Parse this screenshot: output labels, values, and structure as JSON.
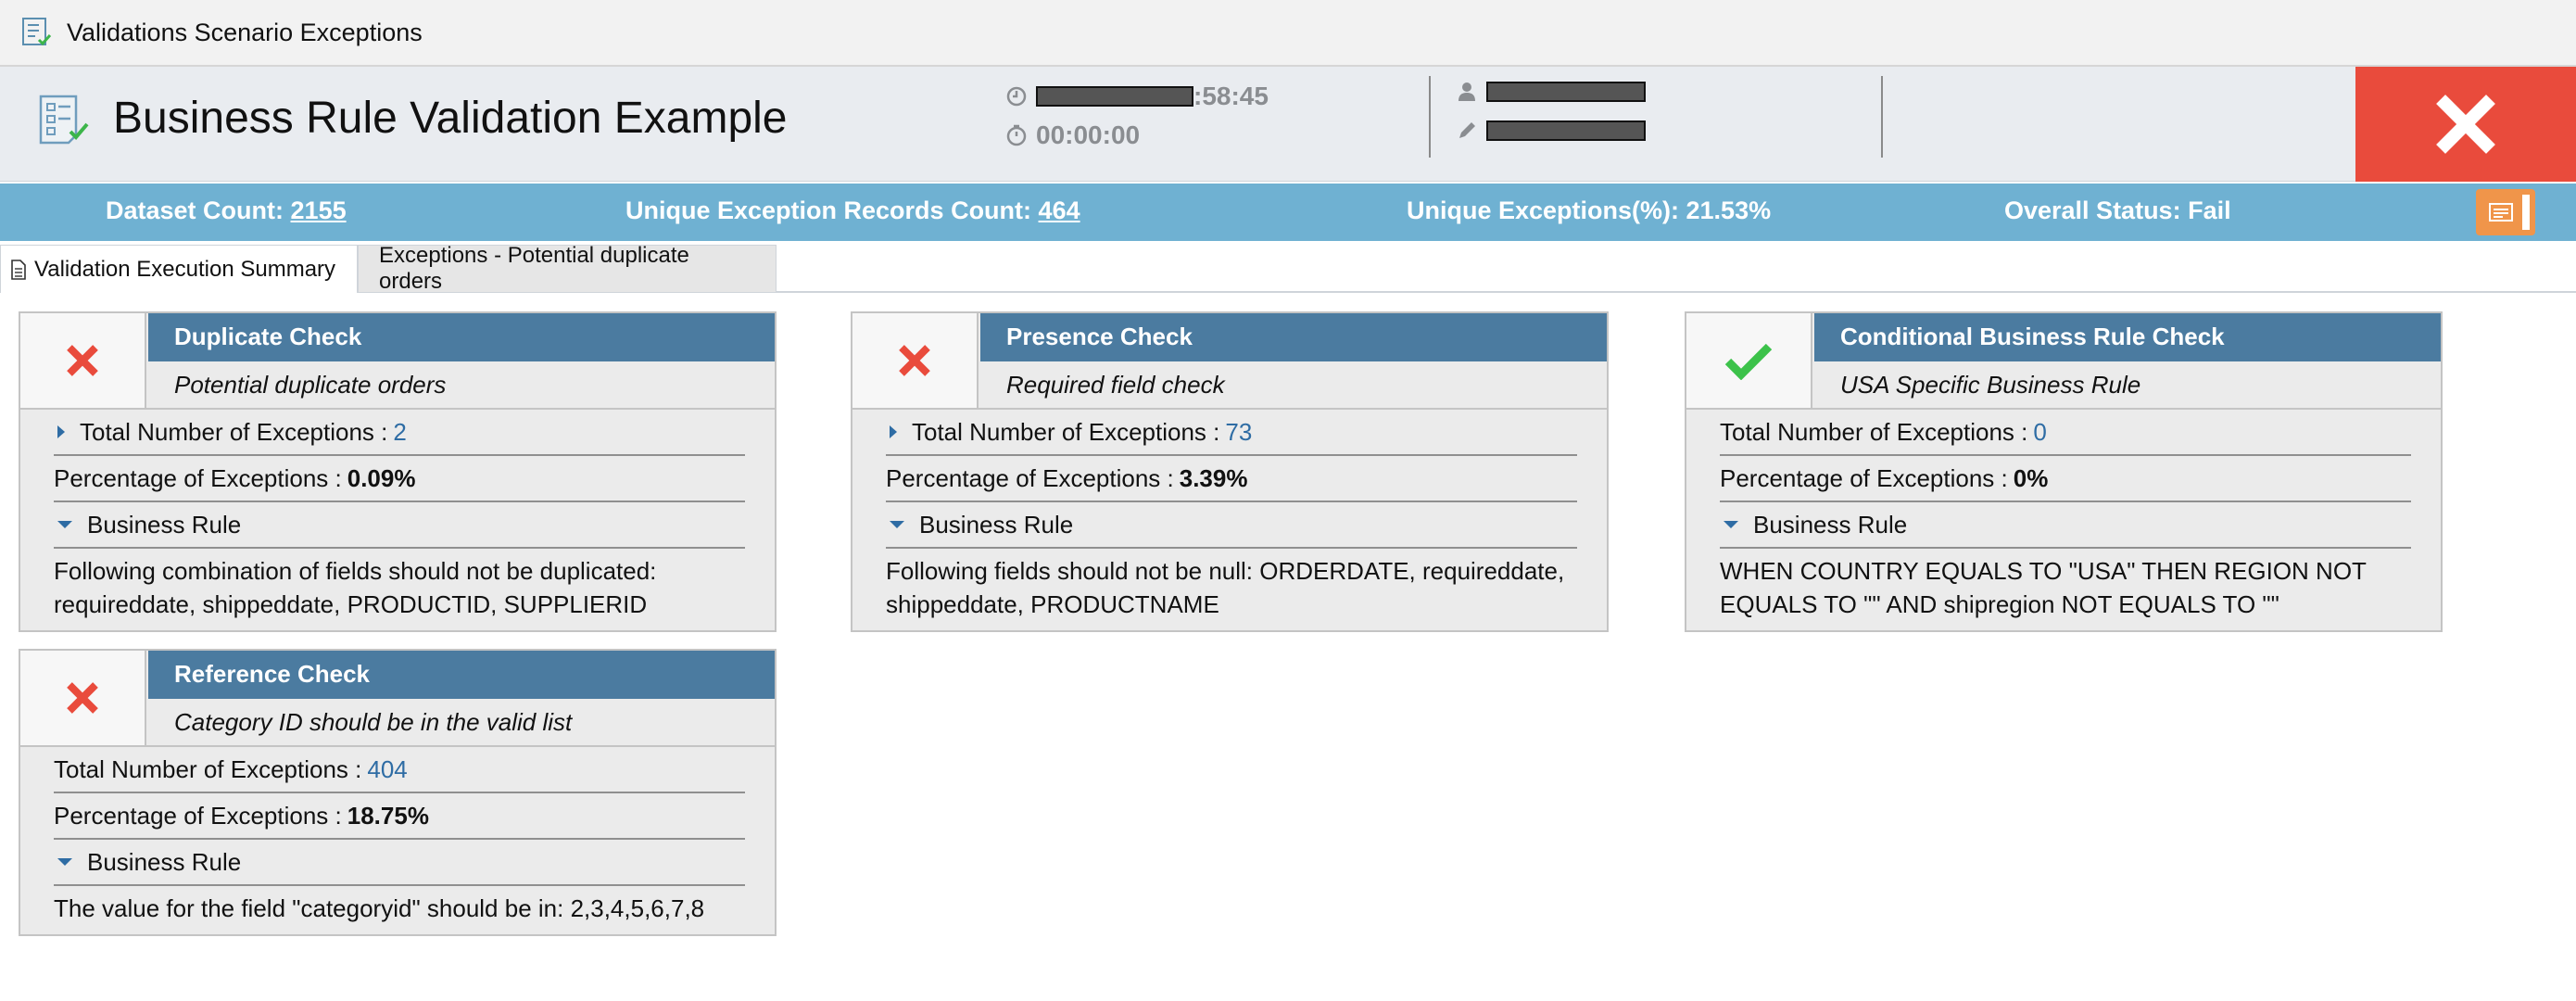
{
  "window": {
    "title": "Validations Scenario Exceptions",
    "icon": "checklist-icon"
  },
  "header": {
    "title": "Business Rule Validation Example",
    "date_time_visible": ":58:45",
    "elapsed": "00:00:00",
    "user_icon": "user-icon",
    "edit_icon": "pencil-icon",
    "close_icon": "close-icon",
    "close_color": "#e94b3c"
  },
  "status_bar": {
    "dataset_label": "Dataset Count:",
    "dataset_value": "2155",
    "unique_records_label": "Unique Exception Records Count:",
    "unique_records_value": "464",
    "unique_pct": "Unique Exceptions(%): 21.53%",
    "overall_status": "Overall Status: Fail",
    "report_icon": "report-icon",
    "color": "#6fb1d2"
  },
  "tabs": [
    {
      "label": "Validation Execution Summary",
      "active": true
    },
    {
      "label": "Exceptions - Potential duplicate orders",
      "active": false
    }
  ],
  "labels": {
    "total_exceptions": "Total Number of Exceptions :",
    "pct_exceptions": "Percentage of Exceptions :",
    "business_rule": "Business Rule"
  },
  "cards": [
    {
      "name": "Duplicate Check",
      "description": "Potential duplicate orders",
      "status": "fail",
      "total": "2",
      "percentage": "0.09%",
      "rule": "Following combination of fields should not be duplicated: requireddate, shippeddate, PRODUCTID, SUPPLIERID"
    },
    {
      "name": "Presence Check",
      "description": "Required field check",
      "status": "fail",
      "total": "73",
      "percentage": "3.39%",
      "rule": "Following fields should not be null: ORDERDATE, requireddate, shippeddate, PRODUCTNAME"
    },
    {
      "name": "Conditional Business Rule Check",
      "description": "USA Specific Business Rule",
      "status": "pass",
      "total": "0",
      "percentage": "0%",
      "rule": "WHEN COUNTRY EQUALS TO \"USA\" THEN REGION NOT EQUALS TO \"\" AND shipregion NOT EQUALS TO \"\""
    },
    {
      "name": "Reference Check",
      "description": "Category ID should be in the valid list",
      "status": "fail",
      "total": "404",
      "percentage": "18.75%",
      "rule": "The value for the field \"categoryid\" should be in: 2,3,4,5,6,7,8"
    }
  ],
  "colors": {
    "header_bar": "#4b7ba0",
    "fail": "#e94b3c",
    "pass": "#3cc24a",
    "link": "#2e6ca4"
  }
}
